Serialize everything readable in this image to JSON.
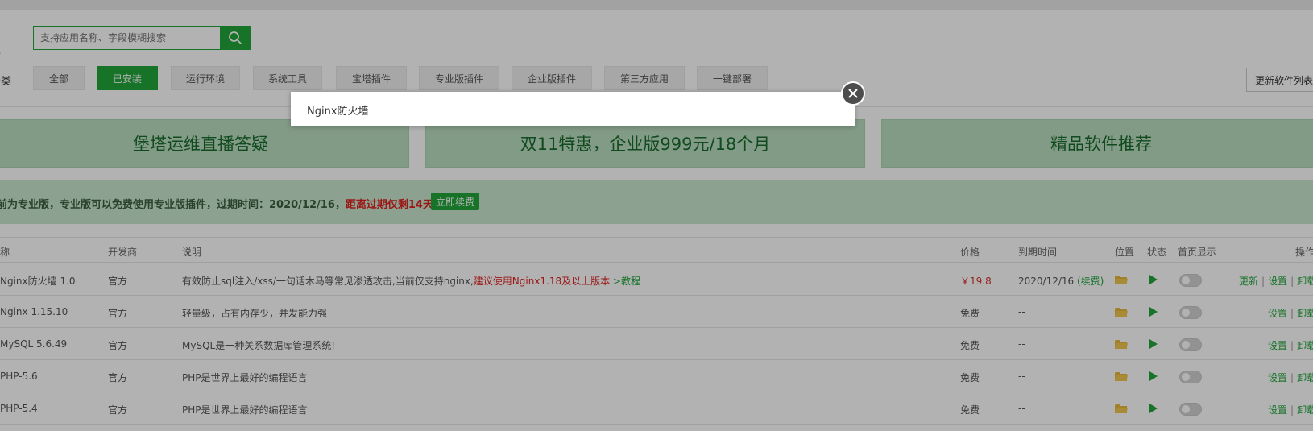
{
  "search": {
    "label": "搜索",
    "placeholder": "支持应用名称、字段模糊搜索"
  },
  "categories": {
    "label": "分类",
    "items": [
      "全部",
      "已安装",
      "运行环境",
      "系统工具",
      "宝塔插件",
      "专业版插件",
      "企业版插件",
      "第三方应用",
      "一键部署"
    ],
    "active": "已安装",
    "update_button": "更新软件列表"
  },
  "banners": [
    "堡塔运维直播答疑",
    "双11特惠，企业版999元/18个月",
    "精品软件推荐"
  ],
  "notice": {
    "text": "前为专业版，专业版可以免费使用专业版插件，过期时间：2020/12/16，",
    "warning": "距离过期仅剩14天",
    "renew_button": "立即续费"
  },
  "table": {
    "headers": [
      "名称",
      "开发商",
      "说明",
      "价格",
      "到期时间",
      "位置",
      "状态",
      "首页显示",
      "操作"
    ],
    "rows": [
      {
        "name": "Nginx防火墙 1.0",
        "developer": "官方",
        "desc": "有效防止sql注入/xss/一句话木马等常见渗透攻击,当前仅支持nginx,",
        "desc_warn": "建议使用Nginx1.18及以上版本",
        "desc_link": ">教程",
        "price": "￥19.8",
        "expire": "2020/12/16",
        "expire_link": "(续费)",
        "ops": [
          "更新",
          "设置",
          "卸载"
        ]
      },
      {
        "name": "Nginx 1.15.10",
        "developer": "官方",
        "desc": "轻量级，占有内存少，并发能力强",
        "price": "免费",
        "expire": "--",
        "ops": [
          "设置",
          "卸载"
        ]
      },
      {
        "name": "MySQL 5.6.49",
        "developer": "官方",
        "desc": "MySQL是一种关系数据库管理系统!",
        "price": "免费",
        "expire": "--",
        "ops": [
          "设置",
          "卸载"
        ]
      },
      {
        "name": "PHP-5.6",
        "developer": "官方",
        "desc": "PHP是世界上最好的编程语言",
        "price": "免费",
        "expire": "--",
        "ops": [
          "设置",
          "卸载"
        ]
      },
      {
        "name": "PHP-5.4",
        "developer": "官方",
        "desc": "PHP是世界上最好的编程语言",
        "price": "免费",
        "expire": "--",
        "ops": [
          "设置",
          "卸载"
        ]
      }
    ]
  },
  "dialog": {
    "title": "Nginx防火墙"
  },
  "colors": {
    "accent": "#20a53a",
    "warning": "#e02020",
    "price": "#d4312b"
  }
}
